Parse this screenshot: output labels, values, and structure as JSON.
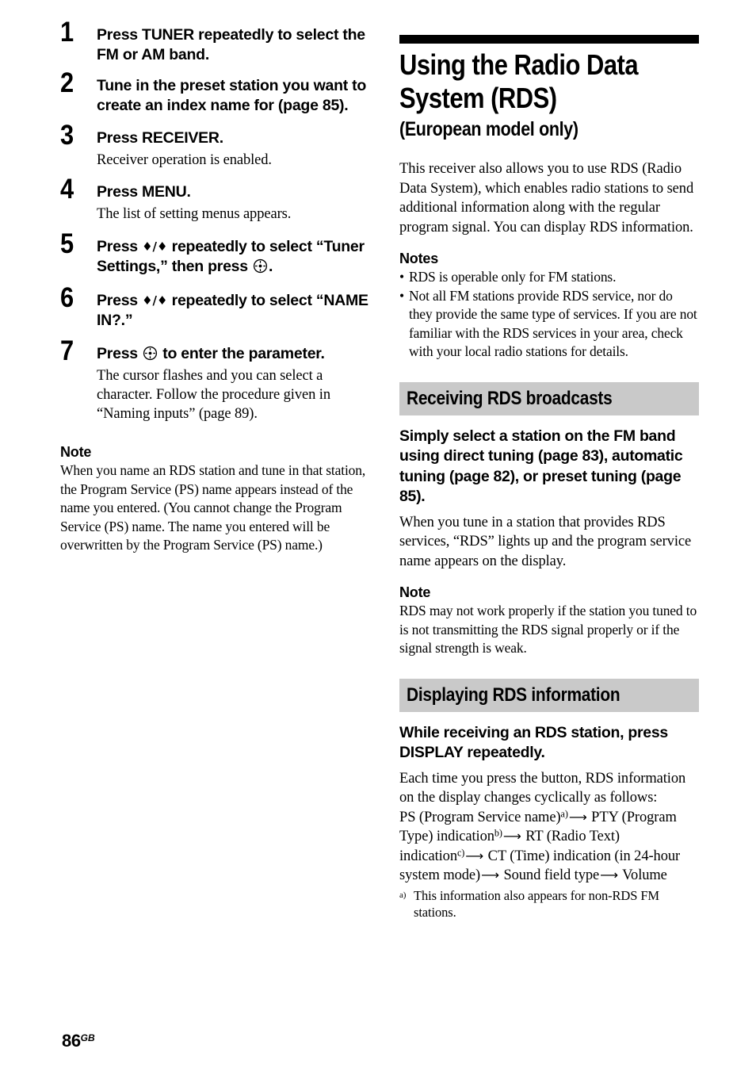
{
  "page": {
    "number": "86",
    "region_code": "GB"
  },
  "left_column": {
    "steps": [
      {
        "num": "1",
        "title_parts": [
          "Press TUNER repeatedly to select the FM or AM band."
        ],
        "body": ""
      },
      {
        "num": "2",
        "title_parts": [
          "Tune in the preset station you want to create an index name for (page 85)."
        ],
        "body": ""
      },
      {
        "num": "3",
        "title_parts": [
          "Press RECEIVER."
        ],
        "body": "Receiver operation is enabled."
      },
      {
        "num": "4",
        "title_parts": [
          "Press MENU."
        ],
        "body": "The list of setting menus appears."
      },
      {
        "num": "5",
        "title_parts": [
          "Press ",
          "♦/♦",
          " repeatedly to select “Tuner Settings,” then press ",
          "enter-button-icon",
          "."
        ],
        "body": ""
      },
      {
        "num": "6",
        "title_parts": [
          "Press ",
          "♦/♦",
          " repeatedly to select “NAME IN?.”"
        ],
        "body": ""
      },
      {
        "num": "7",
        "title_parts": [
          "Press ",
          "enter-button-icon",
          " to enter the parameter."
        ],
        "body": "The cursor flashes and you can select a character. Follow the procedure given in “Naming inputs” (page 89)."
      }
    ],
    "step1_title": "Press TUNER repeatedly to select the FM or AM band.",
    "step2_title": "Tune in the preset station you want to create an index name for (page 85).",
    "step3_title": "Press RECEIVER.",
    "step3_body": "Receiver operation is enabled.",
    "step4_title": "Press MENU.",
    "step4_body": "The list of setting menus appears.",
    "step5_pre": "Press ",
    "step5_arrows": "♦/♦",
    "step5_mid": " repeatedly to select “Tuner Settings,” then press ",
    "step5_post": ".",
    "step6_pre": "Press ",
    "step6_arrows": "♦/♦",
    "step6_mid": " repeatedly to select “NAME IN?.”",
    "step7_pre": "Press ",
    "step7_post": " to enter the parameter.",
    "step7_body": "The cursor flashes and you can select a character. Follow the procedure given in “Naming inputs” (page 89).",
    "note_heading": "Note",
    "note_body": "When you name an RDS station and tune in that station, the Program Service (PS) name appears instead of the name you entered. (You cannot change the Program Service (PS) name. The name you entered will be overwritten by the Program Service (PS) name.)"
  },
  "right_column": {
    "chapter_title": "Using the Radio Data System (RDS)",
    "chapter_subtitle": "(European model only)",
    "intro": "This receiver also allows you to use RDS (Radio Data System), which enables radio stations to send additional information along with the regular program signal. You can display RDS information.",
    "notes_heading": "Notes",
    "notes": [
      "RDS is operable only for FM stations.",
      "Not all FM stations provide RDS service, nor do they provide the same type of services. If you are not familiar with the RDS services in your area, check with your local radio stations for details."
    ],
    "section1": {
      "heading": "Receiving RDS broadcasts",
      "lead": "Simply select a station on the FM band using direct tuning (page 83), automatic tuning (page 82), or preset tuning (page 85).",
      "para": "When you tune in a station that provides RDS services, “RDS” lights up and the program service name appears on the display.",
      "note_heading": "Note",
      "note_body": "RDS may not work properly if the station you tuned to is not transmitting the RDS signal properly or if the signal strength is weak."
    },
    "section2": {
      "heading": "Displaying RDS information",
      "lead": "While receiving an RDS station, press DISPLAY repeatedly.",
      "para": "Each time you press the button, RDS information on the display changes cyclically as follows:",
      "sequence": {
        "t1": "PS (Program Service name)",
        "s1": "a)",
        "t2": " PTY (Program Type) indication",
        "s2": "b)",
        "t3": " RT (Radio Text) indication",
        "s3": "c)",
        "t4": " CT (Time) indication (in 24-hour system mode)",
        "t5": " Sound field type",
        "t6": " Volume",
        "arrow": "⟶"
      },
      "footnote_mark": "a)",
      "footnote_text": "This information also appears for non-RDS FM stations."
    }
  },
  "colors": {
    "section_header_bg": "#c9c9c9",
    "rule_black": "#000000",
    "text": "#000000",
    "page_bg": "#ffffff"
  }
}
